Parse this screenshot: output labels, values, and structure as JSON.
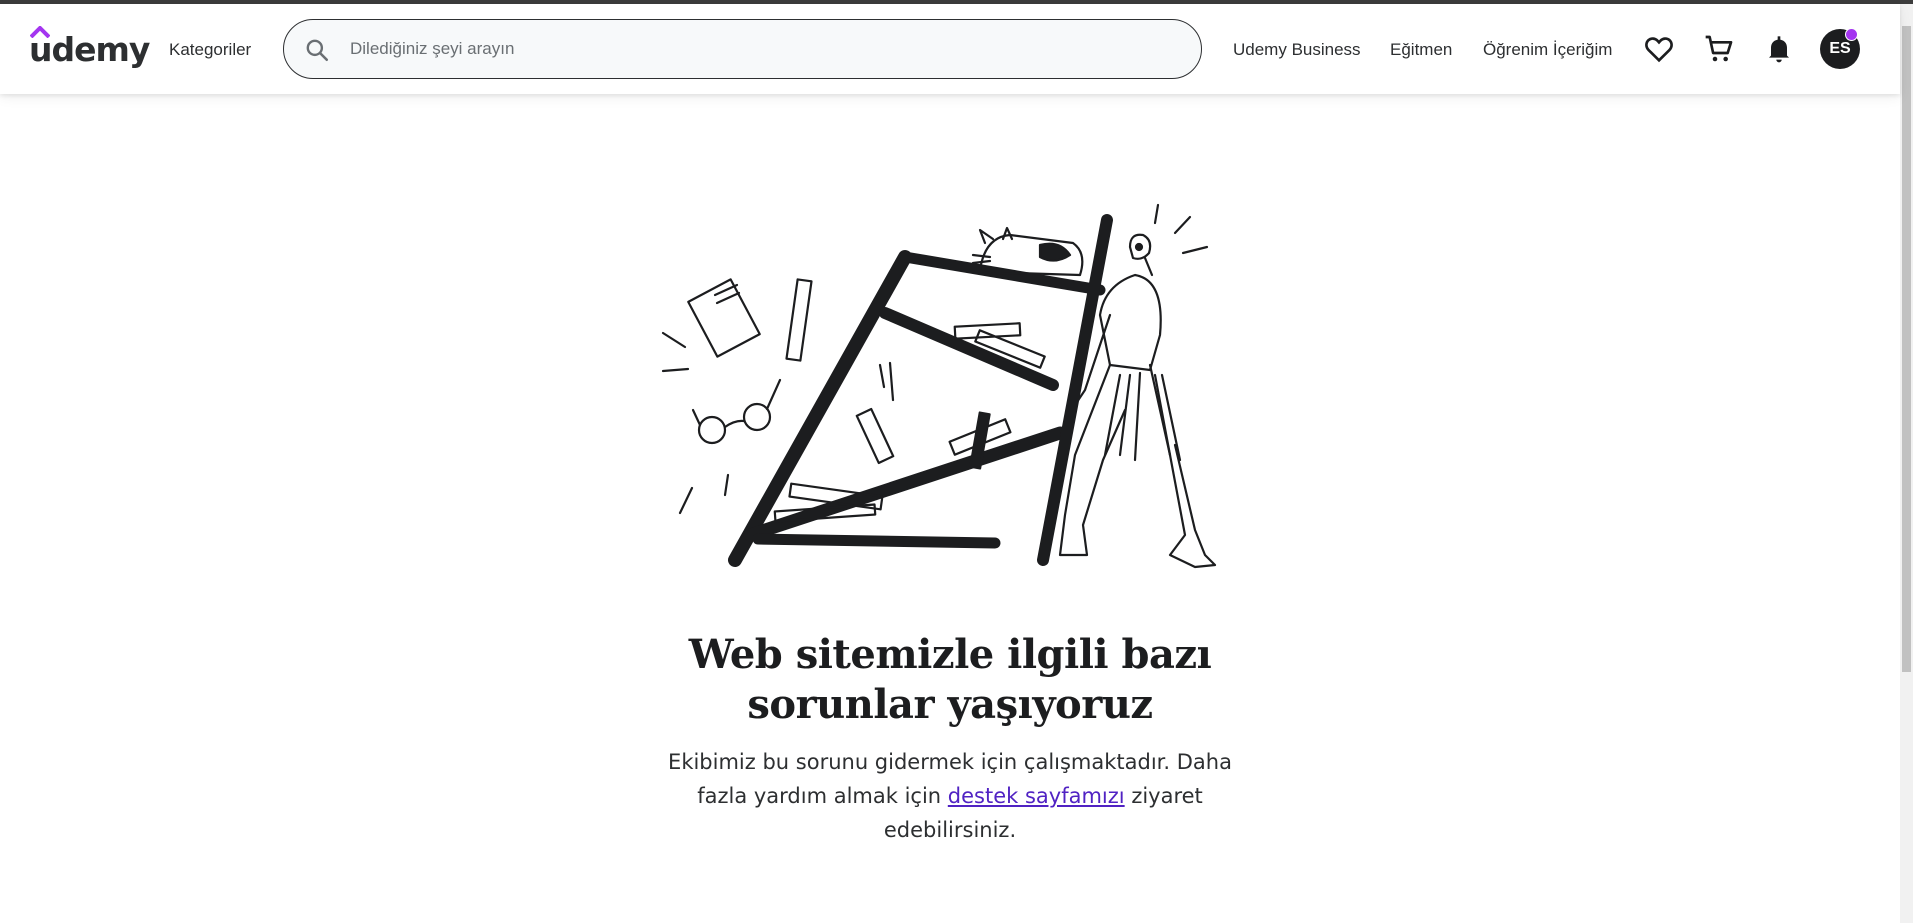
{
  "header": {
    "logo_text": "udemy",
    "categories_label": "Kategoriler",
    "search_placeholder": "Dilediğiniz şeyi arayın",
    "udemy_business_label": "Udemy Business",
    "instructor_label": "Eğitmen",
    "my_learning_label": "Öğrenim İçeriğim",
    "wishlist_icon": "heart-icon",
    "cart_icon": "cart-icon",
    "notifications_icon": "bell-icon",
    "avatar_initials": "ES"
  },
  "error": {
    "title_line1": "Web sitemizle ilgili bazı",
    "title_line2": "sorunlar yaşıyoruz",
    "desc_before": "Ekibimiz bu sorunu gidermek için çalışmaktadır. Daha fazla yardım almak için ",
    "support_link": "destek sayfamızı",
    "desc_after": " ziyaret edebilirsiniz."
  },
  "colors": {
    "brand_purple": "#a435f0",
    "link_purple": "#5022c3",
    "text_dark": "#1c1d1f"
  }
}
